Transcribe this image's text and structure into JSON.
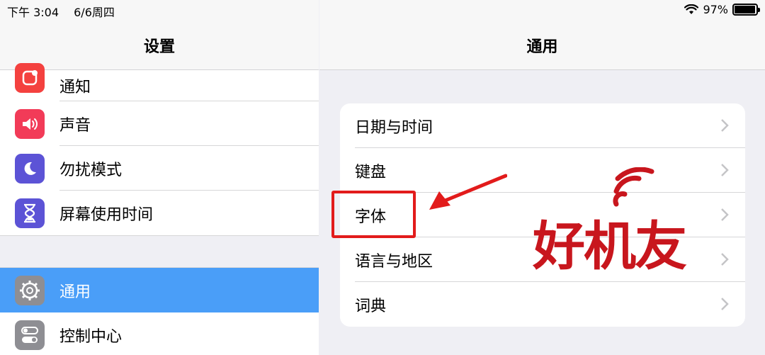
{
  "status_bar": {
    "time": "下午 3:04",
    "date": "6/6周四",
    "battery_percent": "97%",
    "battery_level": 0.97
  },
  "left_panel": {
    "title": "设置",
    "group_a": [
      {
        "label": "通知",
        "icon": "notification-icon",
        "color": "#f4413f"
      },
      {
        "label": "声音",
        "icon": "sound-icon",
        "color": "#f23b58"
      },
      {
        "label": "勿扰模式",
        "icon": "moon-icon",
        "color": "#5c53d6"
      },
      {
        "label": "屏幕使用时间",
        "icon": "hourglass-icon",
        "color": "#5c53d6"
      }
    ],
    "group_b": [
      {
        "label": "通用",
        "icon": "gear-icon",
        "color": "#8e8e93",
        "selected": true
      },
      {
        "label": "控制中心",
        "icon": "toggle-icon",
        "color": "#8e8e93"
      }
    ]
  },
  "right_panel": {
    "title": "通用",
    "items": [
      {
        "label": "日期与时间"
      },
      {
        "label": "键盘"
      },
      {
        "label": "字体"
      },
      {
        "label": "语言与地区"
      },
      {
        "label": "词典"
      }
    ]
  },
  "annotation": {
    "highlighted_item": "字体",
    "color": "#e21b1b"
  },
  "watermark": {
    "text": "好机友",
    "color": "#c8161d"
  }
}
